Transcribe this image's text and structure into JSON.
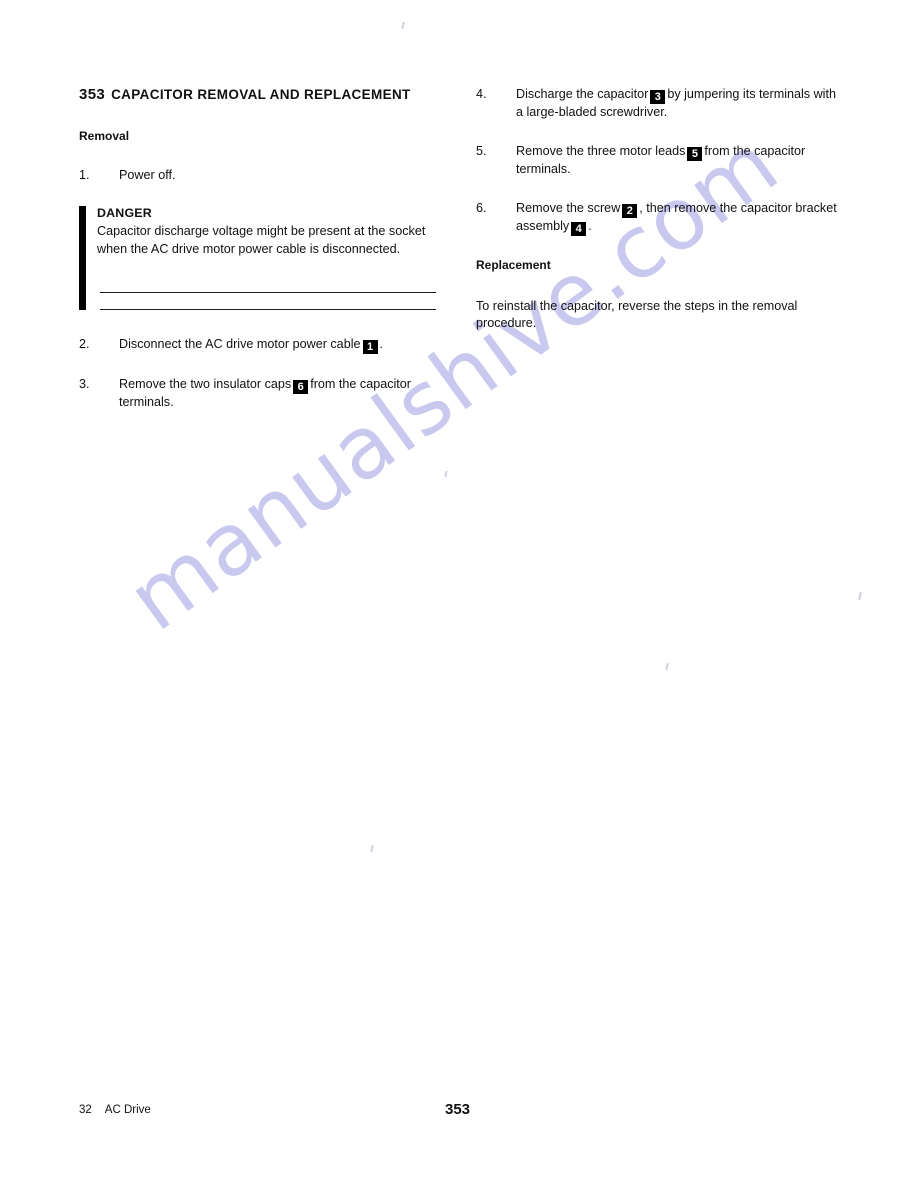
{
  "document": {
    "title_number": "353",
    "title_text": "CAPACITOR REMOVAL AND REPLACEMENT"
  },
  "removal": {
    "heading": "Removal",
    "steps": [
      {
        "number": "1.",
        "text_before": "Power off.",
        "badge": "",
        "text_after": ""
      },
      {
        "number": "2.",
        "text_before": "Disconnect the AC drive motor power cable",
        "badge": "1",
        "text_after": "."
      },
      {
        "number": "3.",
        "text_before": "Remove the two insulator caps",
        "badge": "6",
        "text_after": "from the capacitor terminals."
      }
    ]
  },
  "danger": {
    "title": "DANGER",
    "body": "Capacitor discharge voltage might be present at the socket when the AC drive motor power cable is disconnected."
  },
  "removal_right": {
    "steps": [
      {
        "number": "4.",
        "text_before": "Discharge the capacitor",
        "badge": "3",
        "text_after": "by jumpering its terminals with a large-bladed screwdriver."
      },
      {
        "number": "5.",
        "text_before": "Remove the three motor leads",
        "badge": "5",
        "text_after": "from the capacitor terminals."
      },
      {
        "number": "6.",
        "text_before": "Remove the screw",
        "badge": "2",
        "text_mid": ", then remove the capacitor bracket assembly",
        "badge2": "4",
        "text_after": "."
      }
    ]
  },
  "replacement": {
    "heading": "Replacement",
    "body": "To reinstall the capacitor, reverse the steps in the removal procedure."
  },
  "watermark": {
    "text": "manualshive.com",
    "color": "#c9c9ef"
  },
  "footer": {
    "page_number": "32",
    "manual_name": "AC Drive",
    "section_number": "353"
  }
}
